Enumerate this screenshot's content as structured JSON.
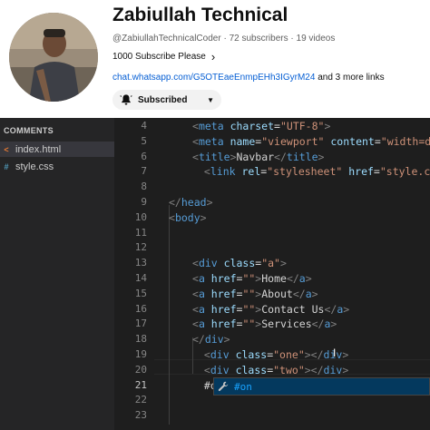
{
  "channel": {
    "name": "Zabiullah Technical",
    "handle": "@ZabiullahTechnicalCoder",
    "subscribers": "72 subscribers",
    "videos": "19 videos",
    "separator": "·",
    "description": "1000 Subscribe Please",
    "link": "chat.whatsapp.com/G5OTEaeEnmpEHh3IGyrM24",
    "more_links": "and 3 more links",
    "subscribe_label": "Subscribed",
    "icons": {
      "bell": "bell-icon",
      "dropdown": "chevron-down-icon",
      "expand": "chevron-right-icon"
    }
  },
  "explorer": {
    "header": "COMMENTS",
    "files": [
      {
        "name": "index.html",
        "icon": "html-file-icon"
      },
      {
        "name": "style.css",
        "icon": "css-file-icon"
      }
    ]
  },
  "editor": {
    "line_numbers": [
      "4",
      "5",
      "6",
      "7",
      "8",
      "9",
      "10",
      "11",
      "12",
      "13",
      "14",
      "15",
      "16",
      "17",
      "18",
      "19",
      "20",
      "21",
      "22",
      "23"
    ],
    "current_line": "21",
    "lines": [
      {
        "tokens": [
          [
            "brk",
            "<"
          ],
          [
            "tag",
            "meta"
          ],
          [
            "att",
            " charset"
          ],
          [
            "eq",
            "="
          ],
          [
            "str",
            "\"UTF-8\""
          ],
          [
            "brk",
            ">"
          ]
        ]
      },
      {
        "tokens": [
          [
            "brk",
            "<"
          ],
          [
            "tag",
            "meta"
          ],
          [
            "att",
            " name"
          ],
          [
            "eq",
            "="
          ],
          [
            "str",
            "\"viewport\""
          ],
          [
            "att",
            " content"
          ],
          [
            "eq",
            "="
          ],
          [
            "str",
            "\"width=devi"
          ]
        ]
      },
      {
        "tokens": [
          [
            "brk",
            "<"
          ],
          [
            "tag",
            "title"
          ],
          [
            "brk",
            ">"
          ],
          [
            "txt",
            "Navbar"
          ],
          [
            "brk",
            "</"
          ],
          [
            "tag",
            "title"
          ],
          [
            "brk",
            ">"
          ]
        ]
      },
      {
        "tokens": [
          [
            "brk",
            " <"
          ],
          [
            "tag",
            "link"
          ],
          [
            "att",
            " rel"
          ],
          [
            "eq",
            "="
          ],
          [
            "str",
            "\"stylesheet\""
          ],
          [
            "att",
            " href"
          ],
          [
            "eq",
            "="
          ],
          [
            "str",
            "\"style.css\""
          ],
          [
            "brk",
            ">"
          ]
        ]
      },
      {
        "tokens": []
      },
      {
        "tokens": [
          [
            "brk",
            "</"
          ],
          [
            "tag",
            "head"
          ],
          [
            "brk",
            ">"
          ]
        ]
      },
      {
        "tokens": [
          [
            "brk",
            "<"
          ],
          [
            "tag",
            "body"
          ],
          [
            "brk",
            ">"
          ]
        ]
      },
      {
        "tokens": []
      },
      {
        "tokens": []
      },
      {
        "tokens": [
          [
            "brk",
            "<"
          ],
          [
            "tag",
            "div"
          ],
          [
            "att",
            " class"
          ],
          [
            "eq",
            "="
          ],
          [
            "str",
            "\"a\""
          ],
          [
            "brk",
            ">"
          ]
        ]
      },
      {
        "tokens": [
          [
            "brk",
            "<"
          ],
          [
            "tag",
            "a"
          ],
          [
            "att",
            " href"
          ],
          [
            "eq",
            "="
          ],
          [
            "str",
            "\"\""
          ],
          [
            "brk",
            ">"
          ],
          [
            "txt",
            "Home"
          ],
          [
            "brk",
            "</"
          ],
          [
            "tag",
            "a"
          ],
          [
            "brk",
            ">"
          ]
        ]
      },
      {
        "tokens": [
          [
            "brk",
            "<"
          ],
          [
            "tag",
            "a"
          ],
          [
            "att",
            " href"
          ],
          [
            "eq",
            "="
          ],
          [
            "str",
            "\"\""
          ],
          [
            "brk",
            ">"
          ],
          [
            "txt",
            "About"
          ],
          [
            "brk",
            "</"
          ],
          [
            "tag",
            "a"
          ],
          [
            "brk",
            ">"
          ]
        ]
      },
      {
        "tokens": [
          [
            "brk",
            "<"
          ],
          [
            "tag",
            "a"
          ],
          [
            "att",
            " href"
          ],
          [
            "eq",
            "="
          ],
          [
            "str",
            "\"\""
          ],
          [
            "brk",
            ">"
          ],
          [
            "txt",
            "Contact Us"
          ],
          [
            "brk",
            "</"
          ],
          [
            "tag",
            "a"
          ],
          [
            "brk",
            ">"
          ]
        ]
      },
      {
        "tokens": [
          [
            "brk",
            "<"
          ],
          [
            "tag",
            "a"
          ],
          [
            "att",
            " href"
          ],
          [
            "eq",
            "="
          ],
          [
            "str",
            "\"\""
          ],
          [
            "brk",
            ">"
          ],
          [
            "txt",
            "Services"
          ],
          [
            "brk",
            "</"
          ],
          [
            "tag",
            "a"
          ],
          [
            "brk",
            ">"
          ]
        ]
      },
      {
        "tokens": [
          [
            "brk",
            "</"
          ],
          [
            "tag",
            "div"
          ],
          [
            "brk",
            ">"
          ]
        ]
      },
      {
        "tokens": [
          [
            "brk",
            " <"
          ],
          [
            "tag",
            "div"
          ],
          [
            "att",
            " class"
          ],
          [
            "eq",
            "="
          ],
          [
            "str",
            "\"one\""
          ],
          [
            "brk",
            "></"
          ],
          [
            "tag",
            "div"
          ],
          [
            "brk",
            ">"
          ]
        ]
      },
      {
        "tokens": [
          [
            "brk",
            " <"
          ],
          [
            "tag",
            "div"
          ],
          [
            "att",
            " class"
          ],
          [
            "eq",
            "="
          ],
          [
            "str",
            "\"two\""
          ],
          [
            "brk",
            "></"
          ],
          [
            "tag",
            "div"
          ],
          [
            "brk",
            ">"
          ]
        ]
      },
      {
        "tokens": [
          [
            "txt",
            " #on"
          ]
        ]
      },
      {
        "tokens": []
      },
      {
        "tokens": []
      }
    ],
    "suggestion": {
      "label": "#on",
      "icon": "wrench-icon"
    }
  },
  "colors": {
    "editor_bg": "#1e1e1e",
    "sidebar_bg": "#252526",
    "tag": "#569cd6",
    "attribute": "#9cdcfe",
    "string": "#ce9178",
    "suggestion_highlight": "#04395e",
    "link": "#065fd4"
  }
}
